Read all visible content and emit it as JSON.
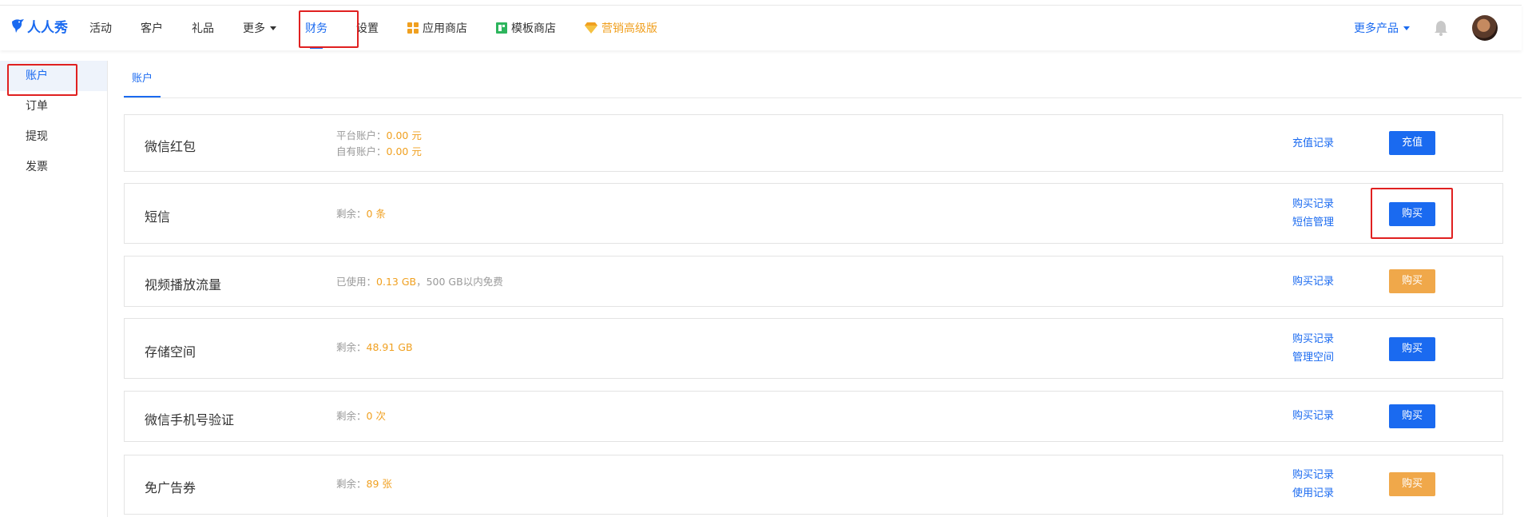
{
  "header": {
    "logo_text": "人人秀",
    "nav": [
      {
        "label": "活动"
      },
      {
        "label": "客户"
      },
      {
        "label": "礼品"
      },
      {
        "label": "更多"
      },
      {
        "label": "财务"
      },
      {
        "label": "设置"
      },
      {
        "label": "应用商店"
      },
      {
        "label": "模板商店"
      },
      {
        "label": "营销高级版"
      }
    ],
    "more_products": "更多产品"
  },
  "sidebar": {
    "items": [
      {
        "label": "账户"
      },
      {
        "label": "订单"
      },
      {
        "label": "提现"
      },
      {
        "label": "发票"
      }
    ]
  },
  "tabs": [
    {
      "label": "账户"
    }
  ],
  "cards": [
    {
      "title": "微信红包",
      "info": [
        {
          "label": "平台账户：",
          "value": "0.00 元"
        },
        {
          "label": "自有账户：",
          "value": "0.00 元"
        }
      ],
      "links": [
        "充值记录"
      ],
      "button": "充值"
    },
    {
      "title": "短信",
      "info": [
        {
          "label": "剩余：",
          "value": "0 条"
        }
      ],
      "links": [
        "购买记录",
        "短信管理"
      ],
      "button": "购买"
    },
    {
      "title": "视频播放流量",
      "info": [
        {
          "label": "已使用：",
          "value": "0.13 GB",
          "suffix": "，500 GB以内免费"
        }
      ],
      "links": [
        "购买记录"
      ],
      "button": "购买"
    },
    {
      "title": "存储空间",
      "info": [
        {
          "label": "剩余：",
          "value": "48.91 GB"
        }
      ],
      "links": [
        "购买记录",
        "管理空间"
      ],
      "button": "购买"
    },
    {
      "title": "微信手机号验证",
      "info": [
        {
          "label": "剩余：",
          "value": "0 次"
        }
      ],
      "links": [
        "购买记录"
      ],
      "button": "购买"
    },
    {
      "title": "免广告券",
      "info": [
        {
          "label": "剩余：",
          "value": "89 张"
        }
      ],
      "links": [
        "购买记录",
        "使用记录"
      ],
      "button": "购买"
    }
  ],
  "colors": {
    "accent": "#1a6af0",
    "warning": "#f0a020",
    "highlight": "#e02020"
  }
}
